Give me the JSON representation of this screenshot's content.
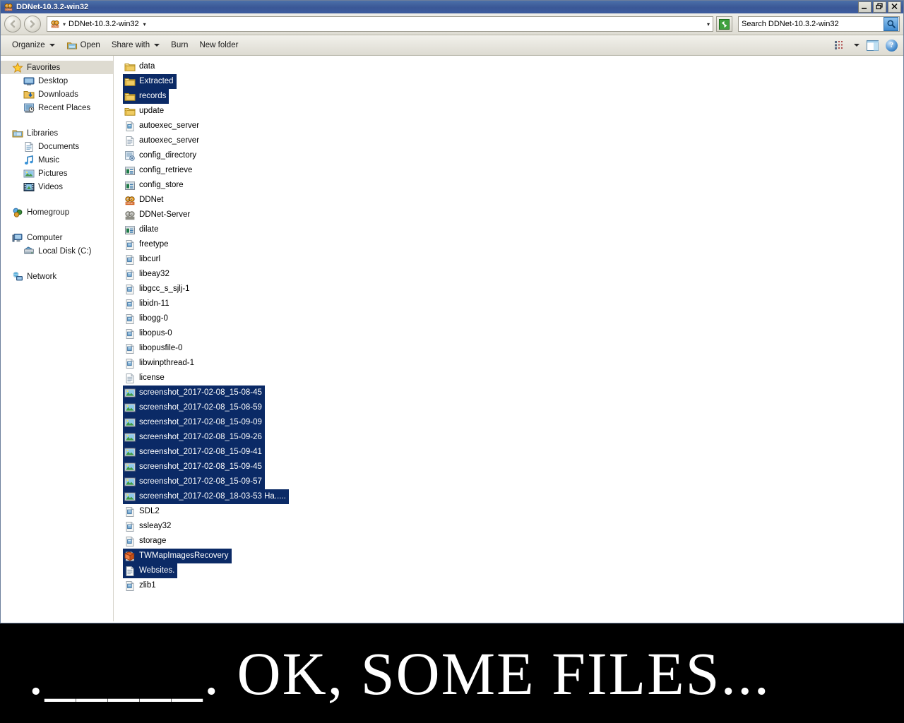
{
  "window": {
    "title": "DDNet-10.3.2-win32",
    "title_icon": "ddnet-icon",
    "buttons": {
      "minimize": "_",
      "maximize": "❐",
      "close": "✕"
    }
  },
  "addressbar": {
    "back_icon": "back-arrow-icon",
    "forward_icon": "forward-arrow-icon",
    "crumb_icon": "ddnet-icon",
    "crumb_text": "DDNet-10.3.2-win32",
    "separator": "▸",
    "dropdown": "▾",
    "refresh_icon": "refresh-icon",
    "search_placeholder": "Search DDNet-10.3.2-win32",
    "search_value": "",
    "search_icon": "search-icon"
  },
  "commandbar": {
    "items": [
      {
        "label": "Organize",
        "icon": "",
        "caret": true
      },
      {
        "label": "Open",
        "icon": "open-folder-icon",
        "caret": false
      },
      {
        "label": "Share with",
        "icon": "",
        "caret": true
      },
      {
        "label": "Burn",
        "icon": "",
        "caret": false
      },
      {
        "label": "New folder",
        "icon": "",
        "caret": false
      }
    ],
    "view_icon": "view-layout-icon",
    "view_caret": "▾",
    "preview_icon": "preview-pane-icon",
    "help_label": "?"
  },
  "navpane": {
    "groups": [
      {
        "header": {
          "label": "Favorites",
          "icon": "star-icon",
          "selected": true
        },
        "items": [
          {
            "label": "Desktop",
            "icon": "desktop-icon"
          },
          {
            "label": "Downloads",
            "icon": "downloads-icon"
          },
          {
            "label": "Recent Places",
            "icon": "recent-places-icon"
          }
        ]
      },
      {
        "header": {
          "label": "Libraries",
          "icon": "libraries-icon",
          "selected": false
        },
        "items": [
          {
            "label": "Documents",
            "icon": "documents-icon"
          },
          {
            "label": "Music",
            "icon": "music-icon"
          },
          {
            "label": "Pictures",
            "icon": "pictures-icon"
          },
          {
            "label": "Videos",
            "icon": "videos-icon"
          }
        ]
      },
      {
        "header": {
          "label": "Homegroup",
          "icon": "homegroup-icon",
          "selected": false
        },
        "items": []
      },
      {
        "header": {
          "label": "Computer",
          "icon": "computer-icon",
          "selected": false
        },
        "items": [
          {
            "label": "Local Disk (C:)",
            "icon": "hard-disk-icon"
          }
        ]
      },
      {
        "header": {
          "label": "Network",
          "icon": "network-icon",
          "selected": false
        },
        "items": []
      }
    ]
  },
  "files": [
    {
      "name": "data",
      "icon": "folder-icon",
      "selected": false
    },
    {
      "name": "Extracted",
      "icon": "folder-icon",
      "selected": true
    },
    {
      "name": "records",
      "icon": "folder-icon",
      "selected": true
    },
    {
      "name": "update",
      "icon": "folder-icon",
      "selected": false
    },
    {
      "name": "autoexec_server",
      "icon": "cfg-file-icon",
      "selected": false
    },
    {
      "name": "autoexec_server",
      "icon": "text-file-icon",
      "selected": false
    },
    {
      "name": "config_directory",
      "icon": "script-file-icon",
      "selected": false
    },
    {
      "name": "config_retrieve",
      "icon": "app-window-icon",
      "selected": false
    },
    {
      "name": "config_store",
      "icon": "app-window-icon",
      "selected": false
    },
    {
      "name": "DDNet",
      "icon": "ddnet-icon",
      "selected": false
    },
    {
      "name": "DDNet-Server",
      "icon": "ddnet-server-icon",
      "selected": false
    },
    {
      "name": "dilate",
      "icon": "app-window-icon",
      "selected": false
    },
    {
      "name": "freetype",
      "icon": "dll-file-icon",
      "selected": false
    },
    {
      "name": "libcurl",
      "icon": "dll-file-icon",
      "selected": false
    },
    {
      "name": "libeay32",
      "icon": "dll-file-icon",
      "selected": false
    },
    {
      "name": "libgcc_s_sjlj-1",
      "icon": "dll-file-icon",
      "selected": false
    },
    {
      "name": "libidn-11",
      "icon": "dll-file-icon",
      "selected": false
    },
    {
      "name": "libogg-0",
      "icon": "dll-file-icon",
      "selected": false
    },
    {
      "name": "libopus-0",
      "icon": "dll-file-icon",
      "selected": false
    },
    {
      "name": "libopusfile-0",
      "icon": "dll-file-icon",
      "selected": false
    },
    {
      "name": "libwinpthread-1",
      "icon": "dll-file-icon",
      "selected": false
    },
    {
      "name": "license",
      "icon": "text-file-icon",
      "selected": false
    },
    {
      "name": "screenshot_2017-02-08_15-08-45",
      "icon": "image-file-icon",
      "selected": true
    },
    {
      "name": "screenshot_2017-02-08_15-08-59",
      "icon": "image-file-icon",
      "selected": true
    },
    {
      "name": "screenshot_2017-02-08_15-09-09",
      "icon": "image-file-icon",
      "selected": true
    },
    {
      "name": "screenshot_2017-02-08_15-09-26",
      "icon": "image-file-icon",
      "selected": true
    },
    {
      "name": "screenshot_2017-02-08_15-09-41",
      "icon": "image-file-icon",
      "selected": true
    },
    {
      "name": "screenshot_2017-02-08_15-09-45",
      "icon": "image-file-icon",
      "selected": true
    },
    {
      "name": "screenshot_2017-02-08_15-09-57",
      "icon": "image-file-icon",
      "selected": true
    },
    {
      "name": "screenshot_2017-02-08_18-03-53 Ha.....",
      "icon": "image-file-icon",
      "selected": true
    },
    {
      "name": "SDL2",
      "icon": "dll-file-icon",
      "selected": false
    },
    {
      "name": "ssleay32",
      "icon": "dll-file-icon",
      "selected": false
    },
    {
      "name": "storage",
      "icon": "dll-file-icon",
      "selected": false
    },
    {
      "name": "TWMapImagesRecovery",
      "icon": "archive-file-icon",
      "selected": true
    },
    {
      "name": "Websites.",
      "icon": "text-file-icon",
      "selected": true
    },
    {
      "name": "zlib1",
      "icon": "dll-file-icon",
      "selected": false
    }
  ],
  "caption": {
    "text": "._____. OK, SOME FILES...",
    "color": "#ffffff",
    "background": "#000000"
  }
}
